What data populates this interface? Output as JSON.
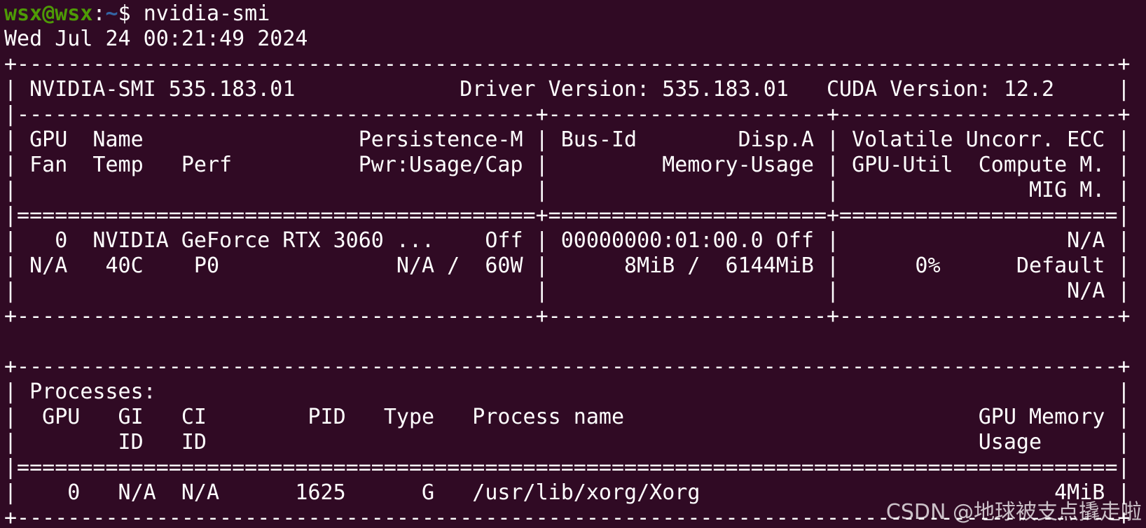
{
  "prompt": {
    "user_host": "wsx@wsx",
    "colon": ":",
    "path": "~",
    "sign": "$ ",
    "command": "nvidia-smi"
  },
  "output_lines": [
    "Wed Jul 24 00:21:49 2024",
    "+---------------------------------------------------------------------------------------+",
    "| NVIDIA-SMI 535.183.01             Driver Version: 535.183.01   CUDA Version: 12.2     |",
    "|-----------------------------------------+----------------------+----------------------+",
    "| GPU  Name                 Persistence-M | Bus-Id        Disp.A | Volatile Uncorr. ECC |",
    "| Fan  Temp   Perf          Pwr:Usage/Cap |         Memory-Usage | GPU-Util  Compute M. |",
    "|                                         |                      |               MIG M. |",
    "|=========================================+======================+======================|",
    "|   0  NVIDIA GeForce RTX 3060 ...    Off | 00000000:01:00.0 Off |                  N/A |",
    "| N/A   40C    P0              N/A /  60W |      8MiB /  6144MiB |      0%      Default |",
    "|                                         |                      |                  N/A |",
    "+-----------------------------------------+----------------------+----------------------+",
    "",
    "+---------------------------------------------------------------------------------------+",
    "| Processes:                                                                            |",
    "|  GPU   GI   CI        PID   Type   Process name                            GPU Memory |",
    "|        ID   ID                                                             Usage      |",
    "|=======================================================================================|",
    "|    0   N/A  N/A      1625      G   /usr/lib/xorg/Xorg                            4MiB |",
    "+---------------------------------------------------------------------------------------+"
  ],
  "watermark": "CSDN @地球被支点撬走啦"
}
